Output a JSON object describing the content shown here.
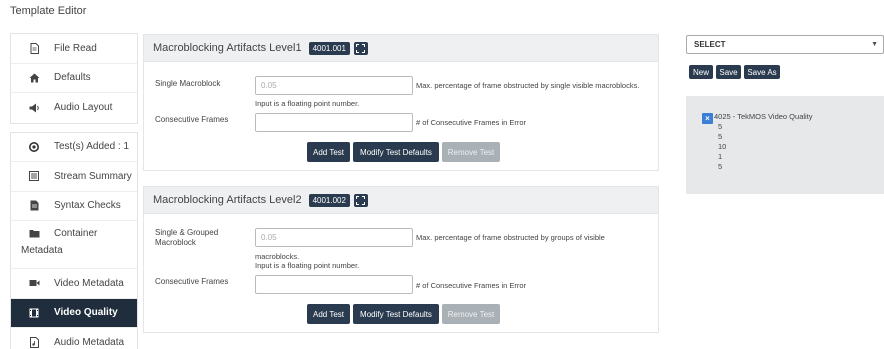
{
  "page_title": "Template Editor",
  "sidebar": {
    "group1": [
      {
        "label": "File Read",
        "icon": "file-icon"
      },
      {
        "label": "Defaults",
        "icon": "home-icon"
      },
      {
        "label": "Audio Layout",
        "icon": "speaker-icon"
      }
    ],
    "group2": [
      {
        "label": "Test(s) Added : 1",
        "icon": "circle-dot-icon"
      },
      {
        "label": "Stream Summary",
        "icon": "list-icon"
      },
      {
        "label": "Syntax Checks",
        "icon": "document-icon"
      },
      {
        "label": "Container",
        "label2": "Metadata",
        "icon": "folder-icon"
      },
      {
        "label": "Video Metadata",
        "icon": "video-camera-icon"
      },
      {
        "label": "Video Quality",
        "icon": "film-icon",
        "active": true
      },
      {
        "label": "Audio Metadata",
        "icon": "audio-file-icon"
      }
    ]
  },
  "panels": [
    {
      "title": "Macroblocking Artifacts Level1",
      "code": "4001.001",
      "fields": [
        {
          "label": "Single Macroblock",
          "placeholder": "0.05",
          "value": "",
          "desc": "Max. percentage of frame obstructed by single visible macroblocks.",
          "hint": "Input is a floating point number."
        },
        {
          "label": "Consecutive Frames",
          "placeholder": "",
          "value": "",
          "desc": "# of Consecutive Frames in Error"
        }
      ],
      "buttons": {
        "add": "Add Test",
        "modify": "Modify Test Defaults",
        "remove": "Remove Test"
      }
    },
    {
      "title": "Macroblocking Artifacts Level2",
      "code": "4001.002",
      "fields": [
        {
          "label": "Single & Grouped",
          "label2": "Macroblock",
          "placeholder": "0.05",
          "value": "",
          "desc": "Max. percentage of frame obstructed by groups of visible",
          "desc2": "macroblocks.",
          "hint": "Input is a floating point number."
        },
        {
          "label": "Consecutive Frames",
          "placeholder": "",
          "value": "",
          "desc": "# of Consecutive Frames in Error"
        }
      ],
      "buttons": {
        "add": "Add Test",
        "modify": "Modify Test Defaults",
        "remove": "Remove Test"
      }
    }
  ],
  "right": {
    "select_value": "SELECT",
    "buttons": {
      "new": "New",
      "save": "Save",
      "save_as": "Save As"
    },
    "tests": [
      {
        "name": "4025 - TekMOS Video Quality",
        "values": [
          "5",
          "5",
          "10",
          "1",
          "5"
        ]
      }
    ]
  },
  "colors": {
    "dark_navy": "#2a3b4f",
    "active_nav": "#1f2d3d",
    "remove_btn_disabled": "#a9b0b6",
    "x_button": "#3a7fd5"
  }
}
